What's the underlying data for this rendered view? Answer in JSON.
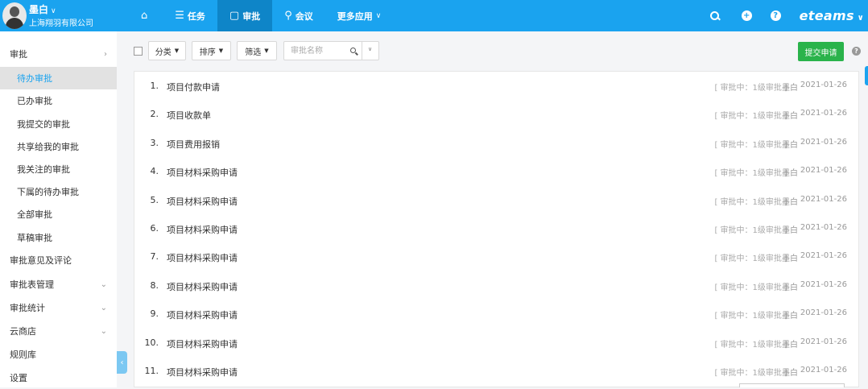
{
  "user": {
    "name": "墨白",
    "company": "上海翔羽有限公司"
  },
  "nav": [
    {
      "label": "任务",
      "icon": "list-icon"
    },
    {
      "label": "审批",
      "icon": "approval-icon"
    },
    {
      "label": "会议",
      "icon": "meeting-icon"
    },
    {
      "label": "更多应用",
      "icon": "chevron-down-icon"
    }
  ],
  "brand": "eteams",
  "sidebar": {
    "items": [
      {
        "label": "审批",
        "arrow": "›"
      },
      {
        "label": "待办审批"
      },
      {
        "label": "已办审批"
      },
      {
        "label": "我提交的审批"
      },
      {
        "label": "共享给我的审批"
      },
      {
        "label": "我关注的审批"
      },
      {
        "label": "下属的待办审批"
      },
      {
        "label": "全部审批"
      },
      {
        "label": "草稿审批"
      },
      {
        "label": "审批意见及评论"
      },
      {
        "label": "审批表管理",
        "arrow": "⌄"
      },
      {
        "label": "审批统计",
        "arrow": "⌄"
      },
      {
        "label": "云商店",
        "arrow": "⌄"
      },
      {
        "label": "规则库"
      },
      {
        "label": "设置"
      }
    ]
  },
  "toolbar": {
    "category": "分类",
    "sort": "排序",
    "filter": "筛选",
    "search_placeholder": "审批名称",
    "submit": "提交申请"
  },
  "list": [
    {
      "num": "1.",
      "title": "项目付款申请",
      "status": "[ 审批中：1级审批 ]",
      "author": "墨白",
      "date": "2021-01-26"
    },
    {
      "num": "2.",
      "title": "项目收款单",
      "status": "[ 审批中：1级审批 ]",
      "author": "墨白",
      "date": "2021-01-26"
    },
    {
      "num": "3.",
      "title": "项目费用报销",
      "status": "[ 审批中：1级审批 ]",
      "author": "墨白",
      "date": "2021-01-26"
    },
    {
      "num": "4.",
      "title": "项目材料采购申请",
      "status": "[ 审批中：1级审批 ]",
      "author": "墨白",
      "date": "2021-01-26"
    },
    {
      "num": "5.",
      "title": "项目材料采购申请",
      "status": "[ 审批中：1级审批 ]",
      "author": "墨白",
      "date": "2021-01-26"
    },
    {
      "num": "6.",
      "title": "项目材料采购申请",
      "status": "[ 审批中：1级审批 ]",
      "author": "墨白",
      "date": "2021-01-26"
    },
    {
      "num": "7.",
      "title": "项目材料采购申请",
      "status": "[ 审批中：1级审批 ]",
      "author": "墨白",
      "date": "2021-01-26"
    },
    {
      "num": "8.",
      "title": "项目材料采购申请",
      "status": "[ 审批中：1级审批 ]",
      "author": "墨白",
      "date": "2021-01-26"
    },
    {
      "num": "9.",
      "title": "项目材料采购申请",
      "status": "[ 审批中：1级审批 ]",
      "author": "墨白",
      "date": "2021-01-26"
    },
    {
      "num": "10.",
      "title": "项目材料采购申请",
      "status": "[ 审批中：1级审批 ]",
      "author": "墨白",
      "date": "2021-01-26"
    },
    {
      "num": "11.",
      "title": "项目材料采购申请",
      "status": "[ 审批中：1级审批 ]",
      "author": "墨白",
      "date": "2021-01-26"
    }
  ]
}
